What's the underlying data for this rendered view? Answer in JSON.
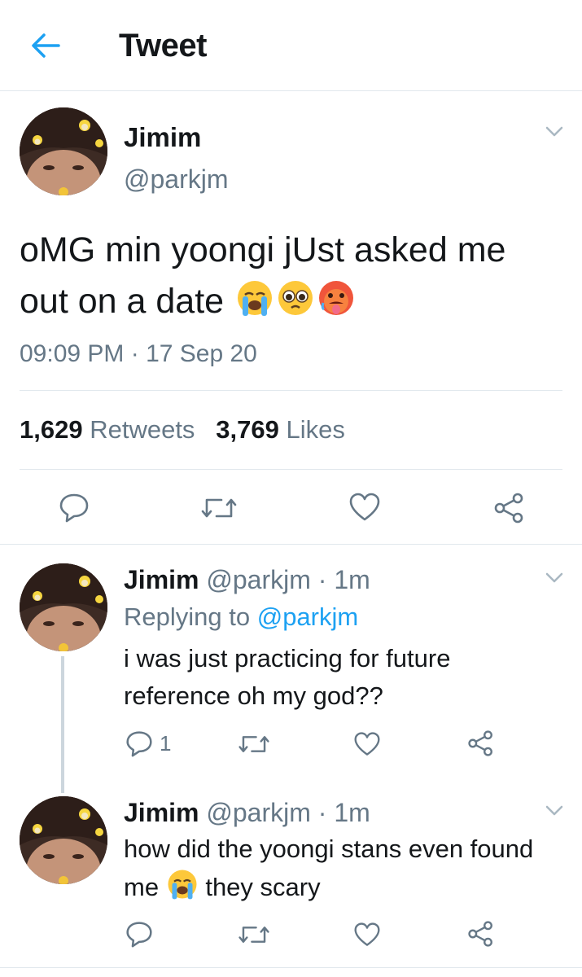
{
  "header": {
    "title": "Tweet"
  },
  "main_tweet": {
    "name": "Jimim",
    "handle": "@parkjm",
    "text": "oMG min yoongi jUst asked me out on a date",
    "emojis": [
      "loudly-crying-face",
      "pleading-face",
      "hot-face"
    ],
    "timestamp": "09:09 PM · 17 Sep 20",
    "retweets_count": "1,629",
    "retweets_label": "Retweets",
    "likes_count": "3,769",
    "likes_label": "Likes"
  },
  "replies": [
    {
      "name": "Jimim",
      "handle": "@parkjm · 1m",
      "replying_prefix": "Replying to",
      "replying_to": "@parkjm",
      "text": "i was just practicing for future reference oh my god??",
      "reply_count": "1"
    },
    {
      "name": "Jimim",
      "handle": "@parkjm · 1m",
      "text_before": "how did the yoongi stans even found me",
      "text_after": "they scary",
      "emoji": "loudly-crying-face"
    }
  ],
  "colors": {
    "accent": "#1da1f2",
    "muted": "#657786",
    "text": "#14171a",
    "divider": "#e1e8ed"
  }
}
